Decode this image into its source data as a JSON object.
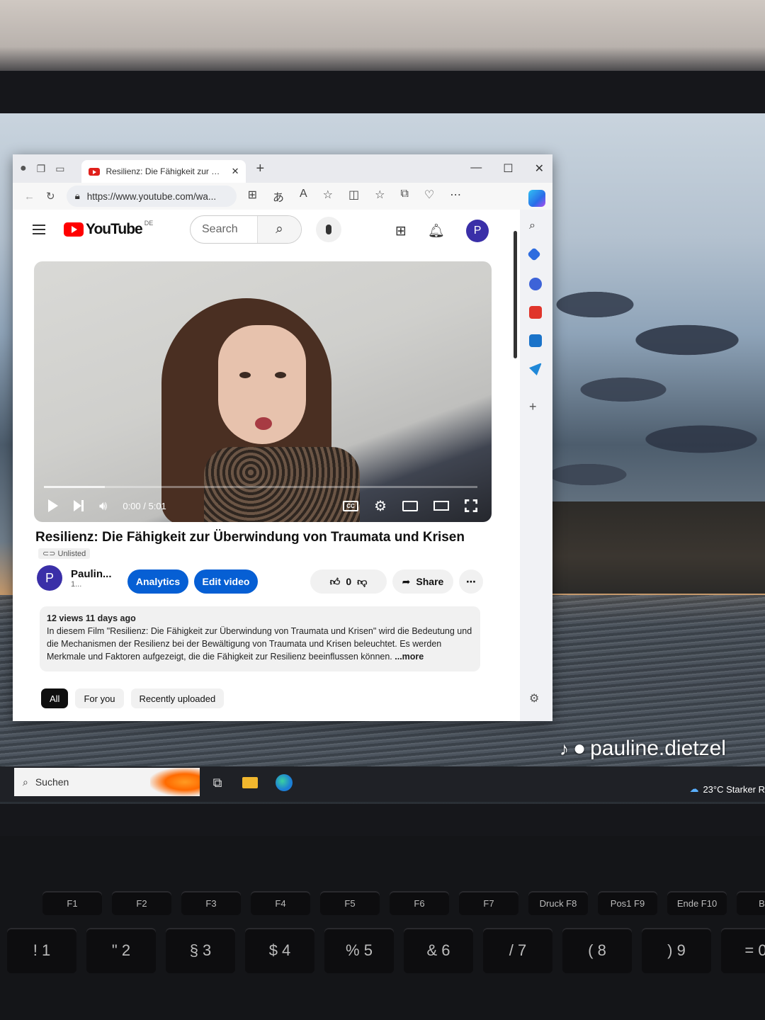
{
  "browser": {
    "tab_title": "Resilienz: Die Fähigkeit zur Über",
    "url": "https://www.youtube.com/wa...",
    "window_controls": [
      "—",
      "☐",
      "✕"
    ]
  },
  "youtube": {
    "logo_text": "YouTube",
    "region": "DE",
    "search_placeholder": "Search",
    "avatar_letter": "P"
  },
  "video": {
    "time": "0:00 / 5:01",
    "progress_fraction": 0,
    "title": "Resilienz: Die Fähigkeit zur Überwindung von Traumata und Krisen",
    "visibility": "Unlisted",
    "channel_name": "Paulin...",
    "channel_sub": "1...",
    "channel_avatar_letter": "P",
    "analytics_label": "Analytics",
    "edit_label": "Edit video",
    "likes": "0",
    "share_label": "Share",
    "views_and_date": "12 views  11 days ago",
    "description": "In diesem Film \"Resilienz: Die Fähigkeit zur Überwindung von Traumata und Krisen\" wird die Bedeutung und die Mechanismen der Resilienz bei der Bewältigung von Traumata und Krisen beleuchtet. Es werden Merkmale und Faktoren aufgezeigt, die die Fähigkeit zur Resilienz beeinflussen können.",
    "more_label": "...more"
  },
  "chips": [
    "All",
    "For you",
    "Recently uploaded"
  ],
  "taskbar": {
    "search_placeholder": "Suchen",
    "weather": "23°C  Starker R"
  },
  "watermark": "pauline.dietzel",
  "keyboard": {
    "fkeys": [
      "F1",
      "F2",
      "F3",
      "F4",
      "F5",
      "F6",
      "F7",
      "Druck F8",
      "Pos1 F9",
      "Ende F10",
      "Bild"
    ],
    "numkeys": [
      "! 1",
      "\" 2",
      "§ 3",
      "$ 4",
      "% 5",
      "& 6",
      "/ 7",
      "( 8",
      ") 9",
      "= 0"
    ]
  },
  "colors": {
    "accent_blue": "#065fd4",
    "youtube_red": "#ff0000",
    "avatar": "#3a2fa8"
  }
}
